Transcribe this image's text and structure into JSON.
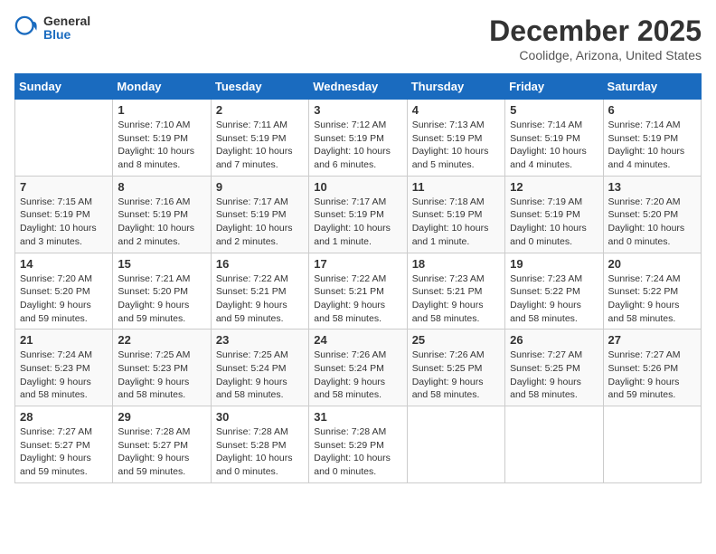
{
  "logo": {
    "general": "General",
    "blue": "Blue"
  },
  "header": {
    "month": "December 2025",
    "location": "Coolidge, Arizona, United States"
  },
  "weekdays": [
    "Sunday",
    "Monday",
    "Tuesday",
    "Wednesday",
    "Thursday",
    "Friday",
    "Saturday"
  ],
  "weeks": [
    [
      {
        "day": null,
        "info": ""
      },
      {
        "day": "1",
        "info": "Sunrise: 7:10 AM\nSunset: 5:19 PM\nDaylight: 10 hours\nand 8 minutes."
      },
      {
        "day": "2",
        "info": "Sunrise: 7:11 AM\nSunset: 5:19 PM\nDaylight: 10 hours\nand 7 minutes."
      },
      {
        "day": "3",
        "info": "Sunrise: 7:12 AM\nSunset: 5:19 PM\nDaylight: 10 hours\nand 6 minutes."
      },
      {
        "day": "4",
        "info": "Sunrise: 7:13 AM\nSunset: 5:19 PM\nDaylight: 10 hours\nand 5 minutes."
      },
      {
        "day": "5",
        "info": "Sunrise: 7:14 AM\nSunset: 5:19 PM\nDaylight: 10 hours\nand 4 minutes."
      },
      {
        "day": "6",
        "info": "Sunrise: 7:14 AM\nSunset: 5:19 PM\nDaylight: 10 hours\nand 4 minutes."
      }
    ],
    [
      {
        "day": "7",
        "info": "Sunrise: 7:15 AM\nSunset: 5:19 PM\nDaylight: 10 hours\nand 3 minutes."
      },
      {
        "day": "8",
        "info": "Sunrise: 7:16 AM\nSunset: 5:19 PM\nDaylight: 10 hours\nand 2 minutes."
      },
      {
        "day": "9",
        "info": "Sunrise: 7:17 AM\nSunset: 5:19 PM\nDaylight: 10 hours\nand 2 minutes."
      },
      {
        "day": "10",
        "info": "Sunrise: 7:17 AM\nSunset: 5:19 PM\nDaylight: 10 hours\nand 1 minute."
      },
      {
        "day": "11",
        "info": "Sunrise: 7:18 AM\nSunset: 5:19 PM\nDaylight: 10 hours\nand 1 minute."
      },
      {
        "day": "12",
        "info": "Sunrise: 7:19 AM\nSunset: 5:19 PM\nDaylight: 10 hours\nand 0 minutes."
      },
      {
        "day": "13",
        "info": "Sunrise: 7:20 AM\nSunset: 5:20 PM\nDaylight: 10 hours\nand 0 minutes."
      }
    ],
    [
      {
        "day": "14",
        "info": "Sunrise: 7:20 AM\nSunset: 5:20 PM\nDaylight: 9 hours\nand 59 minutes."
      },
      {
        "day": "15",
        "info": "Sunrise: 7:21 AM\nSunset: 5:20 PM\nDaylight: 9 hours\nand 59 minutes."
      },
      {
        "day": "16",
        "info": "Sunrise: 7:22 AM\nSunset: 5:21 PM\nDaylight: 9 hours\nand 59 minutes."
      },
      {
        "day": "17",
        "info": "Sunrise: 7:22 AM\nSunset: 5:21 PM\nDaylight: 9 hours\nand 58 minutes."
      },
      {
        "day": "18",
        "info": "Sunrise: 7:23 AM\nSunset: 5:21 PM\nDaylight: 9 hours\nand 58 minutes."
      },
      {
        "day": "19",
        "info": "Sunrise: 7:23 AM\nSunset: 5:22 PM\nDaylight: 9 hours\nand 58 minutes."
      },
      {
        "day": "20",
        "info": "Sunrise: 7:24 AM\nSunset: 5:22 PM\nDaylight: 9 hours\nand 58 minutes."
      }
    ],
    [
      {
        "day": "21",
        "info": "Sunrise: 7:24 AM\nSunset: 5:23 PM\nDaylight: 9 hours\nand 58 minutes."
      },
      {
        "day": "22",
        "info": "Sunrise: 7:25 AM\nSunset: 5:23 PM\nDaylight: 9 hours\nand 58 minutes."
      },
      {
        "day": "23",
        "info": "Sunrise: 7:25 AM\nSunset: 5:24 PM\nDaylight: 9 hours\nand 58 minutes."
      },
      {
        "day": "24",
        "info": "Sunrise: 7:26 AM\nSunset: 5:24 PM\nDaylight: 9 hours\nand 58 minutes."
      },
      {
        "day": "25",
        "info": "Sunrise: 7:26 AM\nSunset: 5:25 PM\nDaylight: 9 hours\nand 58 minutes."
      },
      {
        "day": "26",
        "info": "Sunrise: 7:27 AM\nSunset: 5:25 PM\nDaylight: 9 hours\nand 58 minutes."
      },
      {
        "day": "27",
        "info": "Sunrise: 7:27 AM\nSunset: 5:26 PM\nDaylight: 9 hours\nand 59 minutes."
      }
    ],
    [
      {
        "day": "28",
        "info": "Sunrise: 7:27 AM\nSunset: 5:27 PM\nDaylight: 9 hours\nand 59 minutes."
      },
      {
        "day": "29",
        "info": "Sunrise: 7:28 AM\nSunset: 5:27 PM\nDaylight: 9 hours\nand 59 minutes."
      },
      {
        "day": "30",
        "info": "Sunrise: 7:28 AM\nSunset: 5:28 PM\nDaylight: 10 hours\nand 0 minutes."
      },
      {
        "day": "31",
        "info": "Sunrise: 7:28 AM\nSunset: 5:29 PM\nDaylight: 10 hours\nand 0 minutes."
      },
      {
        "day": null,
        "info": ""
      },
      {
        "day": null,
        "info": ""
      },
      {
        "day": null,
        "info": ""
      }
    ]
  ]
}
